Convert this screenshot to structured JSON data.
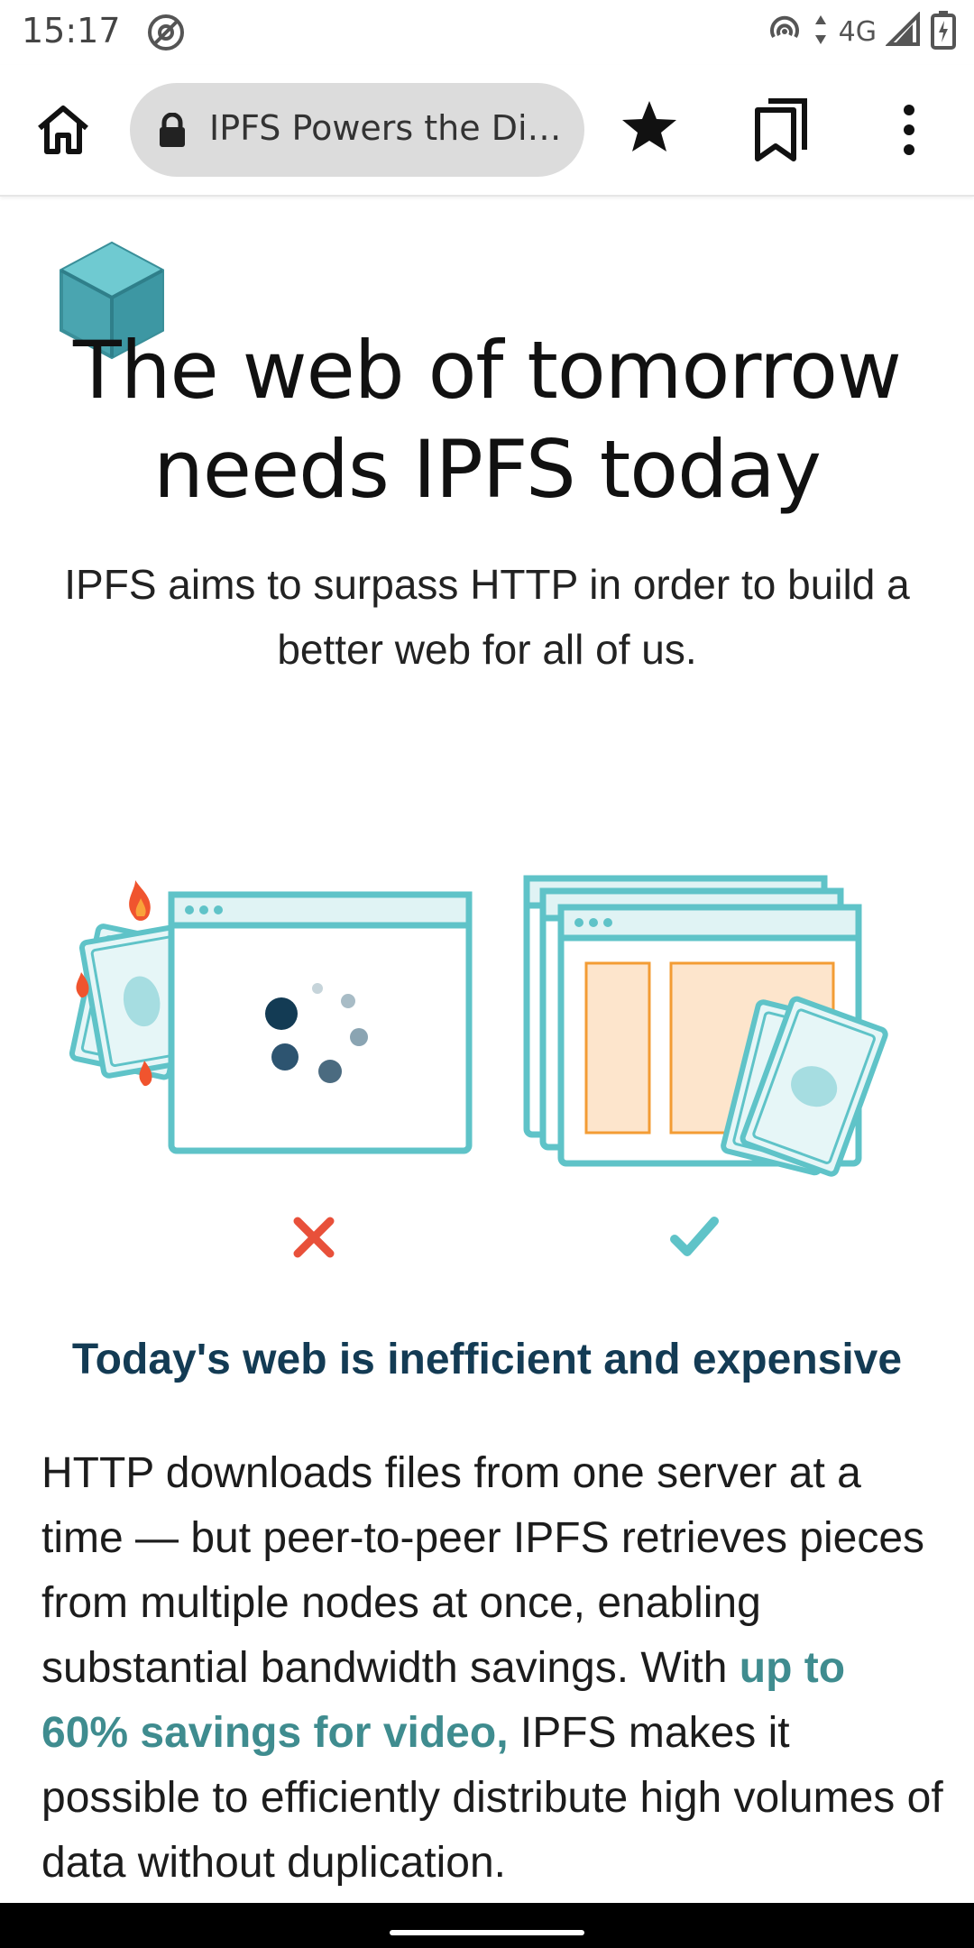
{
  "status": {
    "time": "15:17",
    "network": "4G"
  },
  "toolbar": {
    "url_title": "IPFS Powers the Di…"
  },
  "hero": {
    "headline_line1": "The web of tomorrow",
    "headline_line2": "needs IPFS today",
    "subline": "IPFS aims to surpass HTTP in order to build a better web for all of us."
  },
  "section": {
    "title": "Today's web is inefficient and expensive",
    "body_part1": "HTTP downloads files from one server at a time — but peer-to-peer IPFS retrieves pieces from multiple nodes at once, enabling substantial bandwidth savings. With ",
    "body_highlight": "up to 60% savings for video,",
    "body_part2": " IPFS makes it possible to efficiently distribute high volumes of data without duplication."
  },
  "icons": {
    "home": "home-icon",
    "lock": "lock-icon",
    "star": "star-icon",
    "bookmarks": "bookmarks-icon",
    "menu": "more-vert-icon"
  },
  "colors": {
    "teal_accent": "#3f8c8f",
    "title_navy": "#133b54",
    "reject": "#e8503a",
    "accept": "#5fc3c8",
    "panel_fill": "#fde5cc",
    "panel_stroke": "#f39c34"
  }
}
